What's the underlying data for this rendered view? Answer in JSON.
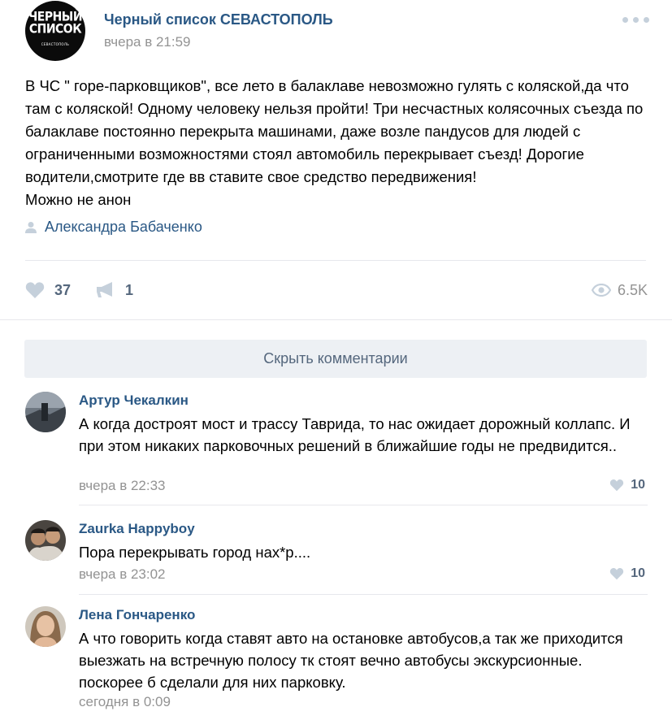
{
  "post": {
    "group_avatar": {
      "line1": "ЧЕРНЫЙ",
      "line2": "СПИСОК",
      "line3": "СЕВАСТОПОЛЬ"
    },
    "group_name": "Черный список СЕВАСТОПОЛЬ",
    "time": "вчера в 21:59",
    "text": "В ЧС \" горе-парковщиков\", все лето в балаклаве невозможно гулять с коляской,да что там с коляской! Одному человеку нельзя пройти! Три несчастных колясочных съезда по балаклаве постоянно перекрыта машинами, даже возле пандусов для людей с ограниченными возможностями стоял автомобиль перекрывает съезд! Дорогие водители,смотрите где вв ставите свое средство передвижения!\nМожно не анон",
    "author": "Александра Бабаченко",
    "likes": "37",
    "shares": "1",
    "views": "6.5K"
  },
  "comments_toggle": "Скрыть комментарии",
  "comments": [
    {
      "name": "Артур Чекалкин",
      "text": "А когда достроят мост и трассу Таврида, то нас ожидает дорожный коллапс. И при этом никаких парковочных решений в ближайшие годы не предвидится..",
      "time": "вчера в 22:33",
      "likes": "10"
    },
    {
      "name": "Zaurka Happyboy",
      "text": "Пора перекрывать город нах*р....",
      "time": "вчера в 23:02",
      "likes": "10"
    },
    {
      "name": "Лена Гончаренко",
      "text": "А что говорить когда ставят авто на остановке автобусов,а так же приходится выезжать на встречную полосу тк стоят вечно автобусы экскурсионные. поскорее б сделали для них парковку.",
      "time": "сегодня в 0:09"
    }
  ],
  "icons": {
    "more": "more-dots-icon",
    "author": "person-icon",
    "like": "heart-icon",
    "share": "megaphone-icon",
    "views": "eye-icon"
  },
  "colors": {
    "link": "#2a5885",
    "secondary": "#939393",
    "icon": "#c5d0db",
    "action_text": "#55677d",
    "button_bg": "#edf0f4",
    "divider": "#e7e8ec"
  }
}
